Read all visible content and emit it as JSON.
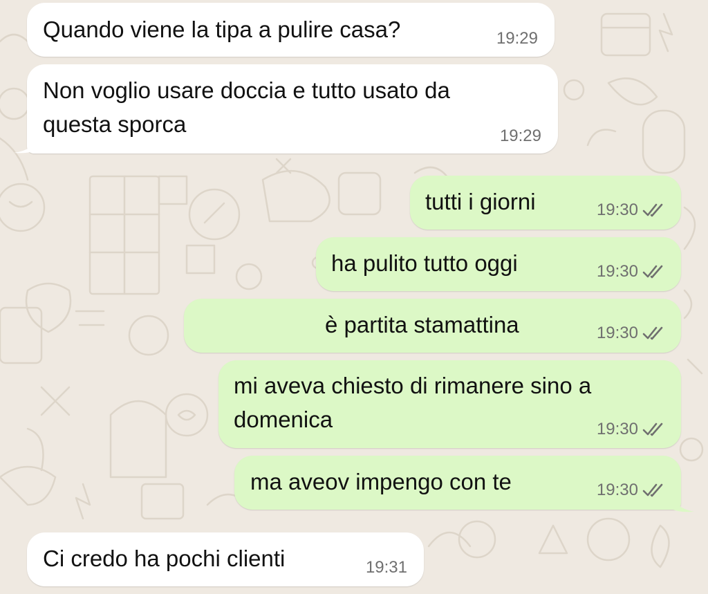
{
  "conversation": {
    "messages": [
      {
        "direction": "incoming",
        "lines": [
          "Quando viene la tipa a pulire casa?"
        ],
        "time": "19:29"
      },
      {
        "direction": "incoming",
        "lines": [
          "Non voglio usare doccia e tutto usato da",
          "questa sporca"
        ],
        "time": "19:29"
      },
      {
        "direction": "outgoing",
        "lines": [
          "tutti i giorni"
        ],
        "time": "19:30",
        "status": "read"
      },
      {
        "direction": "outgoing",
        "lines": [
          "ha pulito tutto oggi"
        ],
        "time": "19:30",
        "status": "read"
      },
      {
        "direction": "outgoing",
        "lines": [
          "è partita stamattina"
        ],
        "time": "19:30",
        "status": "read"
      },
      {
        "direction": "outgoing",
        "lines": [
          "mi aveva chiesto di rimanere sino a",
          "domenica"
        ],
        "time": "19:30",
        "status": "read"
      },
      {
        "direction": "outgoing",
        "lines": [
          "ma aveov impengo con te"
        ],
        "time": "19:30",
        "status": "read"
      },
      {
        "direction": "incoming",
        "lines": [
          "Ci credo ha pochi clienti"
        ],
        "time": "19:31"
      }
    ]
  },
  "theme": {
    "background": "#efe9e1",
    "incoming_bubble": "#ffffff",
    "outgoing_bubble": "#dcf8c6",
    "text_color": "#111111",
    "meta_color": "#6f6f6f",
    "read_ticks_icon": "double-check-icon"
  }
}
